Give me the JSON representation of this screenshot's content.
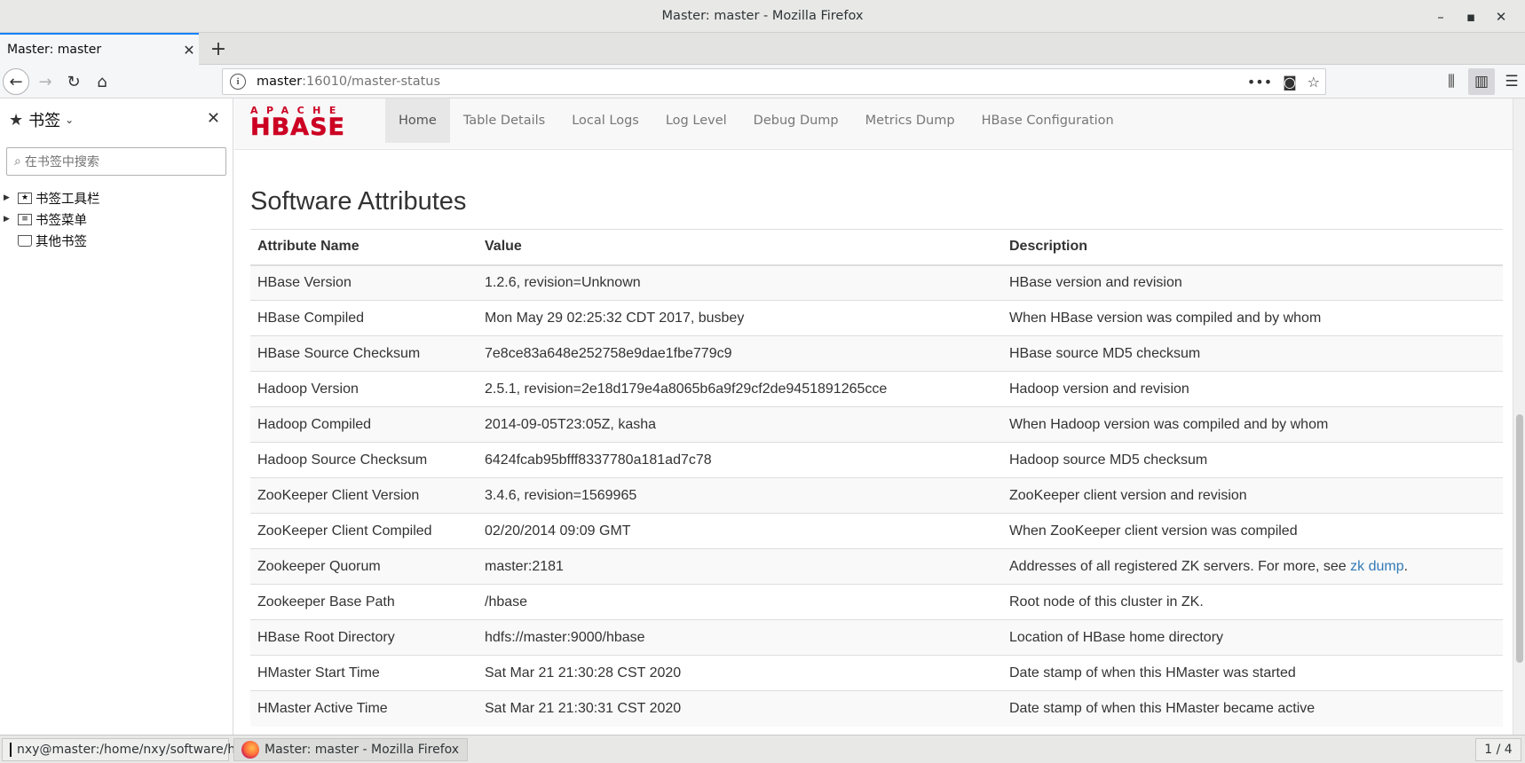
{
  "window": {
    "title": "Master: master - Mozilla Firefox"
  },
  "tab": {
    "title": "Master: master"
  },
  "urlbar": {
    "host": "master",
    "rest": ":16010/master-status"
  },
  "sidebar": {
    "title": "书签",
    "search_placeholder": "在书签中搜索",
    "items": [
      {
        "label": "书签工具栏",
        "expandable": true
      },
      {
        "label": "书签菜单",
        "expandable": true
      },
      {
        "label": "其他书签",
        "expandable": false
      }
    ]
  },
  "hbase": {
    "logo_top": "APACHE",
    "logo_main": "HBASE",
    "menu": [
      "Home",
      "Table Details",
      "Local Logs",
      "Log Level",
      "Debug Dump",
      "Metrics Dump",
      "HBase Configuration"
    ],
    "active_menu": "Home"
  },
  "section": {
    "title": "Software Attributes"
  },
  "table": {
    "headers": [
      "Attribute Name",
      "Value",
      "Description"
    ],
    "rows": [
      [
        "HBase Version",
        "1.2.6, revision=Unknown",
        "HBase version and revision"
      ],
      [
        "HBase Compiled",
        "Mon May 29 02:25:32 CDT 2017, busbey",
        "When HBase version was compiled and by whom"
      ],
      [
        "HBase Source Checksum",
        "7e8ce83a648e252758e9dae1fbe779c9",
        "HBase source MD5 checksum"
      ],
      [
        "Hadoop Version",
        "2.5.1, revision=2e18d179e4a8065b6a9f29cf2de9451891265cce",
        "Hadoop version and revision"
      ],
      [
        "Hadoop Compiled",
        "2014-09-05T23:05Z, kasha",
        "When Hadoop version was compiled and by whom"
      ],
      [
        "Hadoop Source Checksum",
        "6424fcab95bfff8337780a181ad7c78",
        "Hadoop source MD5 checksum"
      ],
      [
        "ZooKeeper Client Version",
        "3.4.6, revision=1569965",
        "ZooKeeper client version and revision"
      ],
      [
        "ZooKeeper Client Compiled",
        "02/20/2014 09:09 GMT",
        "When ZooKeeper client version was compiled"
      ],
      [
        "Zookeeper Quorum",
        "master:2181",
        "Addresses of all registered ZK servers. For more, see "
      ],
      [
        "Zookeeper Base Path",
        "/hbase",
        "Root node of this cluster in ZK."
      ],
      [
        "HBase Root Directory",
        "hdfs://master:9000/hbase",
        "Location of HBase home directory"
      ],
      [
        "HMaster Start Time",
        "Sat Mar 21 21:30:28 CST 2020",
        "Date stamp of when this HMaster was started"
      ],
      [
        "HMaster Active Time",
        "Sat Mar 21 21:30:31 CST 2020",
        "Date stamp of when this HMaster became active"
      ]
    ],
    "zk_link": "zk dump",
    "zk_link_suffix": "."
  },
  "taskbar": {
    "terminal": "nxy@master:/home/nxy/software/h-...",
    "firefox": "Master: master - Mozilla Firefox",
    "pager": "1 / 4"
  }
}
